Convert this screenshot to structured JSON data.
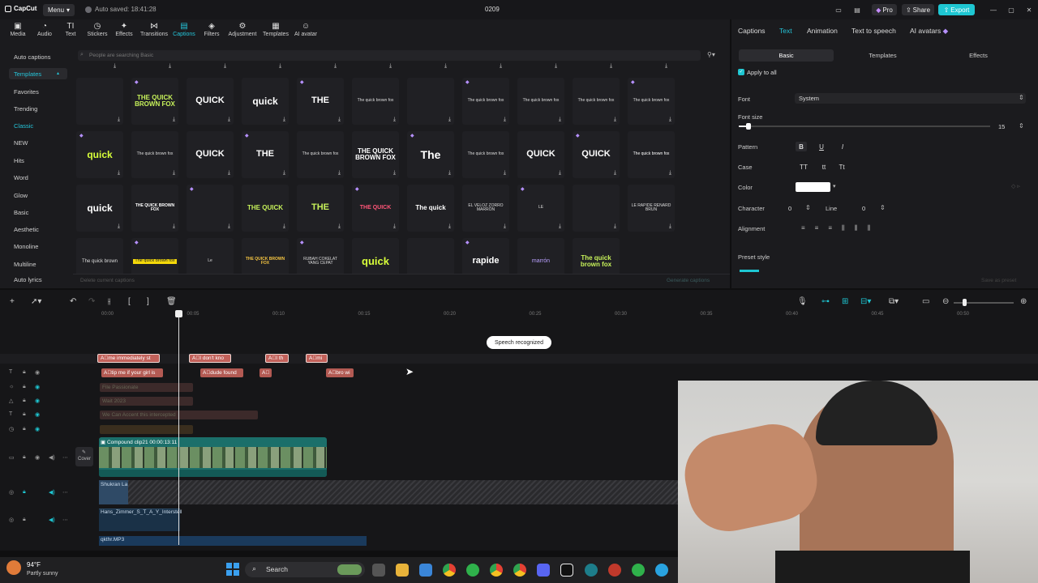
{
  "titlebar": {
    "app": "CapCut",
    "menu": "Menu",
    "autosave": "Auto saved: 18:41:28",
    "project": "0209",
    "pro": "Pro",
    "share": "Share",
    "export": "Export"
  },
  "toolbar": {
    "items": [
      "Media",
      "Audio",
      "Text",
      "Stickers",
      "Effects",
      "Transitions",
      "Captions",
      "Filters",
      "Adjustment",
      "Templates",
      "AI avatar"
    ]
  },
  "leftnav": {
    "items": [
      "Auto captions",
      "Templates",
      "Favorites",
      "Trending",
      "Classic",
      "NEW",
      "Hits",
      "Word",
      "Glow",
      "Basic",
      "Aesthetic",
      "Monoline",
      "Multiline",
      "Auto lyrics"
    ]
  },
  "library": {
    "search_placeholder": "People are searching Basic",
    "cards": [
      [
        "",
        "THE QUICK BROWN FOX",
        "QUICK",
        "quick",
        "THE",
        "The quick brown fox",
        "",
        "The quick brown fox",
        "The quick brown fox",
        "The quick brown fox",
        "The quick brown fox"
      ],
      [
        "quick",
        "The quick brown fox",
        "QUICK",
        "THE",
        "The quick brown fox",
        "THE QUICK BROWN FOX",
        "The",
        "The quick brown fox",
        "QUICK",
        "QUICK",
        "The quick brown fox"
      ],
      [
        "quick",
        "THE QUICK BROWN FOX",
        "",
        "THE QUICK",
        "THE",
        "THE QUICK",
        "The quick",
        "EL VELOZ ZORRO MARRÓN",
        "LE",
        "",
        "LE RAPIDE RENARD BRUN"
      ],
      [
        "The quick brown",
        "The quick brown fox",
        "Le",
        "THE QUICK BROWN FOX",
        "RUBAH COKELAT YANG CEPAT",
        "quick",
        "",
        "rapide",
        "marrón",
        "The quick brown fox"
      ]
    ],
    "delete_label": "Delete current captions",
    "generate_label": "Generate captions"
  },
  "rightpanel": {
    "tabs": [
      "Captions",
      "Text",
      "Animation",
      "Text to speech",
      "AI avatars"
    ],
    "subtabs": [
      "Basic",
      "Templates",
      "Effects"
    ],
    "apply_all": "Apply to all",
    "font_label": "Font",
    "font_value": "System",
    "fontsize_label": "Font size",
    "fontsize_value": "15",
    "pattern_label": "Pattern",
    "case_label": "Case",
    "case_opts": [
      "TT",
      "tt",
      "Tt"
    ],
    "color_label": "Color",
    "character_label": "Character",
    "character_value": "0",
    "line_label": "Line",
    "line_value": "0",
    "alignment_label": "Alignment",
    "preset_label": "Preset style",
    "save_preset": "Save as preset"
  },
  "timeline": {
    "ruler": [
      "00:00",
      "00:05",
      "00:10",
      "00:15",
      "00:20",
      "00:25",
      "00:30",
      "00:35",
      "00:40",
      "00:45",
      "00:50"
    ],
    "toast": "Speech recognized",
    "row1": [
      "me immediately st",
      "I don't kno",
      "I th",
      "mi"
    ],
    "row2": [
      "tip me if your girl is",
      "dude found",
      "",
      "bro wi"
    ],
    "faded": [
      "File Passionate",
      "Wait 2023",
      "We Can Accent this intercepted",
      ""
    ],
    "compound": "Compound clip21",
    "compound_time": "00:00:13:11",
    "cover": "Cover",
    "audio1": "Shukran La",
    "audio2": "Hans_Zimmer_S_T_A_Y_Interstell",
    "audio3": "qkthr.MP3"
  },
  "taskbar": {
    "temp": "94°F",
    "weather": "Partly sunny",
    "search": "Search"
  }
}
